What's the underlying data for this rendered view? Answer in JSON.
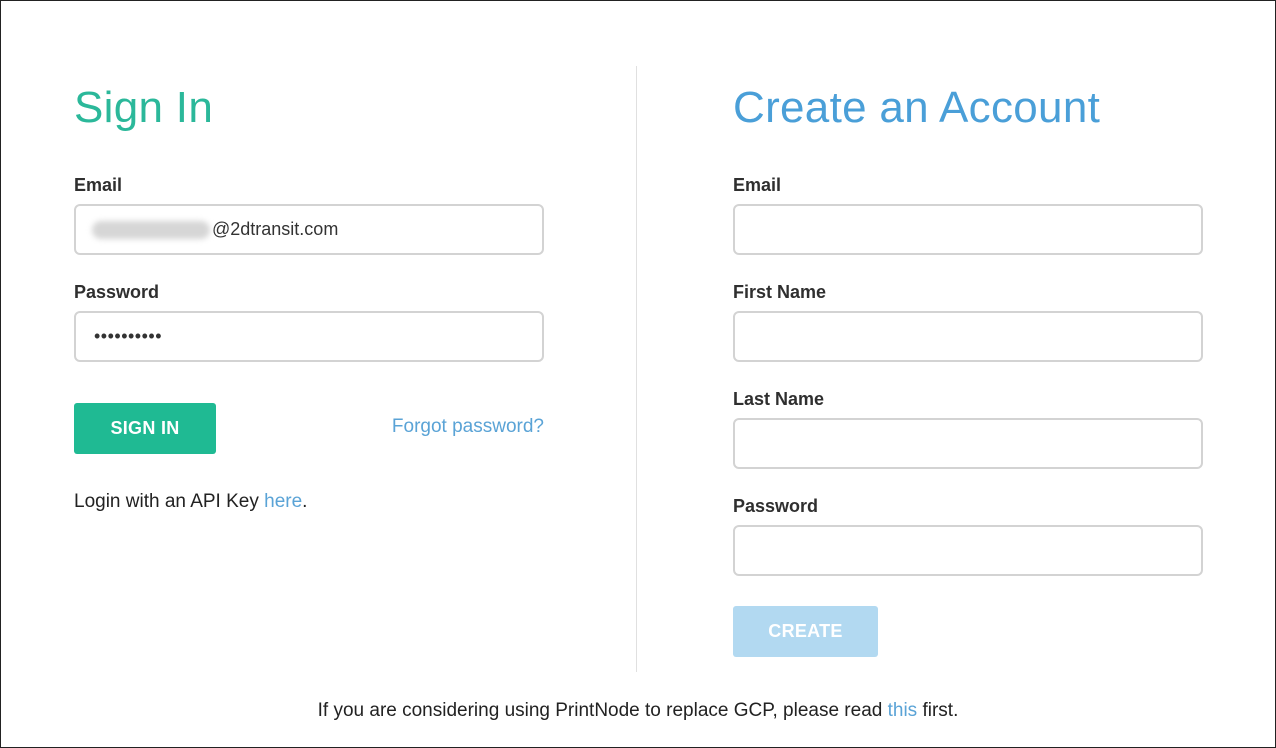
{
  "signin": {
    "title": "Sign In",
    "email_label": "Email",
    "email_domain": "@2dtransit.com",
    "password_label": "Password",
    "password_value": "••••••••••",
    "button_label": "SIGN IN",
    "forgot_link": "Forgot password?",
    "apikey_prefix": "Login with an API Key ",
    "apikey_link": "here",
    "apikey_suffix": "."
  },
  "create": {
    "title": "Create an Account",
    "email_label": "Email",
    "firstname_label": "First Name",
    "lastname_label": "Last Name",
    "password_label": "Password",
    "button_label": "CREATE"
  },
  "footer": {
    "prefix": "If you are considering using PrintNode to replace GCP, please read ",
    "link": "this",
    "suffix": " first."
  },
  "colors": {
    "signin_title": "#2bb89a",
    "create_title": "#4a9fd8",
    "signin_button": "#1fba93",
    "create_button_disabled": "#b2d9f1",
    "link": "#5aa3d6"
  }
}
